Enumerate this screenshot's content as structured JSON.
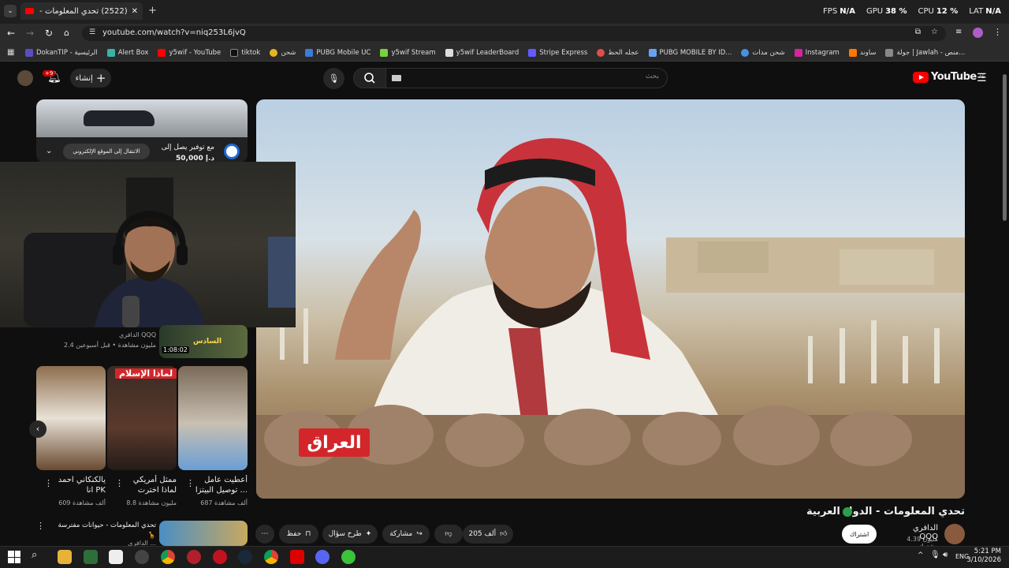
{
  "browser": {
    "tab_title": "(2522) تحدي المعلومات - الدول ا...",
    "url": "youtube.com/watch?v=niq253L6jvQ",
    "stats": [
      {
        "label": "FPS",
        "value": "N/A"
      },
      {
        "label": "GPU",
        "value": "38 %"
      },
      {
        "label": "CPU",
        "value": "12 %"
      },
      {
        "label": "LAT",
        "value": "N/A"
      }
    ],
    "bookmarks": [
      "DokanTIP - الرئيسية",
      "Alert Box",
      "y5wif - YouTube",
      "tiktok",
      "شحن",
      "PUBG Mobile UC",
      "y5wif Stream",
      "y5wif LeaderBoard",
      "Stripe Express",
      "عجله الحظ",
      "PUBG MOBILE BY ID...",
      "شحن مدات",
      "Instagram",
      "ساوند",
      "جولة | Jawlah - منص..."
    ]
  },
  "header": {
    "logo_text": "YouTube",
    "logo_region": "AE",
    "search_placeholder": "بحث",
    "create_label": "إنشاء",
    "notif_badge": "+9"
  },
  "ad": {
    "line1": "مع توفير يصل إلى",
    "line2": "50,000 د.إ",
    "cta": "الانتقال إلى الموقع الإلكتروني"
  },
  "video": {
    "overlay_label": "العراق",
    "title": "تحدي المعلومات - الدول العربية",
    "channel": "الدافري QQQ",
    "subscribers": "4.39 مليون مشترك",
    "subscribe_label": "اشتراك",
    "like_count": "205 ألف",
    "share_label": "مشاركة",
    "ask_label": "طرح سؤال",
    "save_label": "حفظ"
  },
  "sidebar": {
    "partial_item": {
      "channel": "الدافري QQQ",
      "meta": "2.4 مليون مشاهدة • قبل أسبوعين",
      "duration": "1:08:02",
      "thumb_text": "السادس"
    },
    "shorts": [
      {
        "title": "أعطيت عامل توصيل البيتزا ...",
        "views": "687 ألف مشاهدة"
      },
      {
        "title": "ممثل أمريكي لماذا اخترت الإسلام ...",
        "views": "8.8 مليون مشاهدة",
        "thumb_text": "لماذا الإسلام"
      },
      {
        "title": "يالكنكاني احمد انا PK",
        "views": "609 ألف مشاهدة"
      }
    ],
    "next_item": {
      "title": "تحدي المعلومات - حيوانات مفترسة 🦒",
      "meta": "الدافري ..."
    }
  },
  "taskbar": {
    "lang": "ENG",
    "time": "5:21 PM",
    "date": "3/10/2026"
  }
}
